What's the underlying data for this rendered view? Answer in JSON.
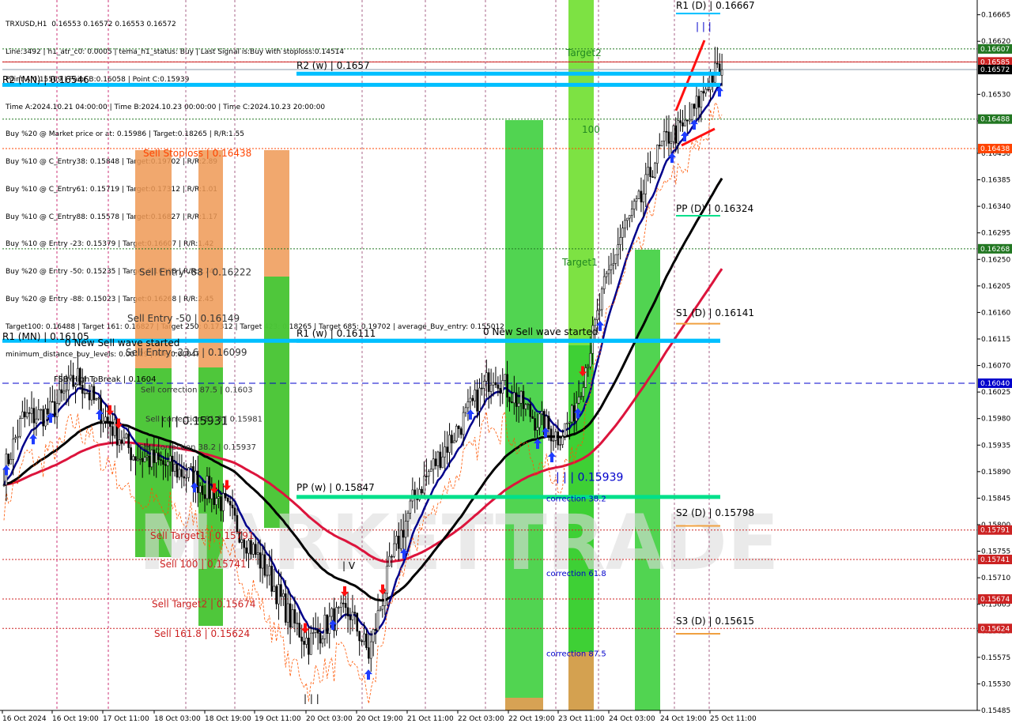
{
  "header": {
    "symbol_line": "TRXUSD,H1  0.16553 0.16572 0.16553 0.16572",
    "info_lines": [
      "Line:3492 | h1_atr_c0: 0.0005 | tema_h1_status: Buy | Last Signal is:Buy with stoploss:0.14514",
      "Point A:0.15509 | Point B:0.16058 | Point C:0.15939",
      "Time A:2024.10.21 04:00:00 | Time B:2024.10.23 00:00:00 | Time C:2024.10.23 20:00:00",
      "Buy %20 @ Market price or at: 0.15986 | Target:0.18265 | R/R:1.55",
      "Buy %10 @ C_Entry38: 0.15848 | Target:0.19702 | R/R:2.89",
      "Buy %10 @ C_Entry61: 0.15719 | Target:0.17312 | R/R:1.01",
      "Buy %10 @ C_Entry88: 0.15578 | Target:0.16827 | R/R:1.17",
      "Buy %10 @ Entry -23: 0.15379 | Target:0.16607 | R/R:1.42",
      "Buy %20 @ Entry -50: 0.15235 | Target:0.16488 | R/R:1.74",
      "Buy %20 @ Entry -88: 0.15023 | Target:0.16268 | R/R:2.45",
      "Target100: 0.16488 | Target 161: 0.16827 | Target 250: 0.17312 | Target 423: 0.18265 | Target 685: 0.19702 | average_Buy_entry: 0.155012",
      "minimum_distance_buy_levels: 0.00129 | ATR:0.00047"
    ]
  },
  "colors": {
    "candle": "#000000",
    "ema_fast": "#00008b",
    "ema_mid": "#000000",
    "ema_slow": "#dc143c",
    "pivot_blue": "#00bfff",
    "pivot_green": "#00e08a",
    "pivot_orange": "#f0a040",
    "sell_orange": "#ee9955",
    "green_zone": "#33cc33",
    "light_green": "#66dd22",
    "hline_red": "#cc2222",
    "hline_green": "#227722",
    "hline_blue": "#0000cc",
    "buy_arrow": "#1e3cff",
    "sell_arrow": "#ff1010"
  },
  "chart_data": {
    "type": "candlestick",
    "symbol": "TRXUSD",
    "timeframe": "H1",
    "ylim": [
      0.15485,
      0.1669
    ],
    "price_ticks": [
      "0.16665",
      "0.16620",
      "0.16530",
      "0.16485",
      "0.16430",
      "0.16385",
      "0.16340",
      "0.16295",
      "0.16250",
      "0.16205",
      "0.16160",
      "0.16115",
      "0.16070",
      "0.16025",
      "0.15980",
      "0.15935",
      "0.15890",
      "0.15845",
      "0.15800",
      "0.15755",
      "0.15710",
      "0.15665",
      "0.15620",
      "0.15575",
      "0.15530",
      "0.15485"
    ],
    "time_ticks": [
      "16 Oct 2024",
      "16 Oct 19:00",
      "17 Oct 11:00",
      "18 Oct 03:00",
      "18 Oct 19:00",
      "19 Oct 11:00",
      "20 Oct 03:00",
      "20 Oct 19:00",
      "21 Oct 11:00",
      "22 Oct 03:00",
      "22 Oct 19:00",
      "23 Oct 11:00",
      "24 Oct 03:00",
      "24 Oct 19:00",
      "25 Oct 11:00"
    ],
    "price_tags": [
      {
        "value": 0.16607,
        "label": "0.16607",
        "color": "#227722"
      },
      {
        "value": 0.16585,
        "label": "0.16585",
        "color": "#cc2222"
      },
      {
        "value": 0.16572,
        "label": "0.16572",
        "color": "#000000"
      },
      {
        "value": 0.16488,
        "label": "0.16488",
        "color": "#227722"
      },
      {
        "value": 0.16438,
        "label": "0.16438",
        "color": "#ff4400"
      },
      {
        "value": 0.16268,
        "label": "0.16268",
        "color": "#227722"
      },
      {
        "value": 0.1604,
        "label": "0.16040",
        "color": "#0000cc"
      },
      {
        "value": 0.15791,
        "label": "0.15791",
        "color": "#cc2222"
      },
      {
        "value": 0.15741,
        "label": "0.15741",
        "color": "#cc2222"
      },
      {
        "value": 0.15674,
        "label": "0.15674",
        "color": "#cc2222"
      },
      {
        "value": 0.15624,
        "label": "0.15624",
        "color": "#cc2222"
      }
    ],
    "pivots": [
      {
        "label": "R1 (D) | 0.16667",
        "value": 0.16667,
        "color": "#00bfff"
      },
      {
        "label": "R2 (w) | 0.1657",
        "value": 0.16565,
        "color": "#00bfff"
      },
      {
        "label": "R2 (MN) | 0.16546",
        "value": 0.16546,
        "color": "#00bfff"
      },
      {
        "label": "PP (D) | 0.16324",
        "value": 0.16324,
        "color": "#00e08a"
      },
      {
        "label": "S1 (D) | 0.16141",
        "value": 0.16141,
        "color": "#f0a040"
      },
      {
        "label": "R1 (MN) | 0.16105",
        "value": 0.16112,
        "color": "#00bfff"
      },
      {
        "label": "R1 (w) | 0.16111",
        "value": 0.16112,
        "color": "#00bfff"
      },
      {
        "label": "PP (w) | 0.15847",
        "value": 0.15847,
        "color": "#00e08a"
      },
      {
        "label": "S2 (D) | 0.15798",
        "value": 0.15798,
        "color": "#f0a040"
      },
      {
        "label": "S3 (D) | 0.15615",
        "value": 0.15615,
        "color": "#f0a040"
      }
    ],
    "annotations": [
      {
        "text": "Sell Stoploss | 0.16438",
        "color": "#ff4400",
        "value": 0.1643
      },
      {
        "text": "Sell Entry -88 | 0.16222",
        "color": "#333333",
        "value": 0.16228
      },
      {
        "text": "Sell Entry -50 | 0.16149",
        "color": "#333333",
        "value": 0.1615
      },
      {
        "text": "Sell Entry -23.6 | 0.16099",
        "color": "#333333",
        "value": 0.16092
      },
      {
        "text": "0 New Sell wave started",
        "color": "#000000",
        "value": 0.16108
      },
      {
        "text": "FSB-HighToBreak | 0.1604",
        "color": "#000000",
        "value": 0.16048
      },
      {
        "text": "Sell correction 87.5 | 0.1603",
        "color": "#333333",
        "value": 0.1603
      },
      {
        "text": "| | | 0.15931",
        "color": "#000000",
        "value": 0.15975
      },
      {
        "text": "Sell correction 61.8 | 0.15981",
        "color": "#333333",
        "value": 0.1598
      },
      {
        "text": "Sell correction 38.2 | 0.15937",
        "color": "#333333",
        "value": 0.15933
      },
      {
        "text": "Sell Target1 | 0.15791",
        "color": "#cc2222",
        "value": 0.15781
      },
      {
        "text": "Sell 100 | 0.15741",
        "color": "#cc2222",
        "value": 0.15733
      },
      {
        "text": "Sell Target2 | 0.15674",
        "color": "#cc2222",
        "value": 0.15665
      },
      {
        "text": "Sell 161.8 | 0.15624",
        "color": "#cc2222",
        "value": 0.15615
      },
      {
        "text": "| V",
        "color": "#000000",
        "value": 0.1573
      },
      {
        "text": "| | |",
        "color": "#000000",
        "value": 0.15505
      },
      {
        "text": "0 New Sell wave started",
        "color": "#000000",
        "value": 0.16127
      },
      {
        "text": "| | | 0.15939",
        "color": "#0000cc",
        "value": 0.1588
      },
      {
        "text": "correction 38.2",
        "color": "#0000cc",
        "value": 0.15845
      },
      {
        "text": "correction 61.8",
        "color": "#0000cc",
        "value": 0.15718
      },
      {
        "text": "correction 87.5",
        "color": "#0000cc",
        "value": 0.15582
      },
      {
        "text": "Target2",
        "color": "#228822",
        "value": 0.166
      },
      {
        "text": "100",
        "color": "#228822",
        "value": 0.1647
      },
      {
        "text": "Target1",
        "color": "#228822",
        "value": 0.16245
      },
      {
        "text": "| | |",
        "color": "#0000cc",
        "value": 0.16645
      }
    ],
    "ohlc_anchors": [
      [
        0,
        0.1589
      ],
      [
        8,
        0.1598
      ],
      [
        20,
        0.1599
      ],
      [
        32,
        0.1605
      ],
      [
        44,
        0.1598
      ],
      [
        56,
        0.1592
      ],
      [
        70,
        0.159
      ],
      [
        82,
        0.1588
      ],
      [
        94,
        0.1584
      ],
      [
        104,
        0.1578
      ],
      [
        114,
        0.1572
      ],
      [
        124,
        0.1564
      ],
      [
        132,
        0.156
      ],
      [
        142,
        0.1564
      ],
      [
        150,
        0.1565
      ],
      [
        158,
        0.1558
      ],
      [
        168,
        0.1574
      ],
      [
        178,
        0.1585
      ],
      [
        186,
        0.159
      ],
      [
        196,
        0.1596
      ],
      [
        206,
        0.1602
      ],
      [
        212,
        0.1606
      ],
      [
        220,
        0.1602
      ],
      [
        230,
        0.1598
      ],
      [
        240,
        0.1595
      ],
      [
        246,
        0.1598
      ],
      [
        252,
        0.1607
      ],
      [
        260,
        0.162
      ],
      [
        268,
        0.163
      ],
      [
        276,
        0.1635
      ],
      [
        282,
        0.1642
      ],
      [
        288,
        0.1646
      ],
      [
        294,
        0.1647
      ],
      [
        300,
        0.1651
      ],
      [
        306,
        0.1656
      ],
      [
        311,
        0.16572
      ]
    ]
  }
}
